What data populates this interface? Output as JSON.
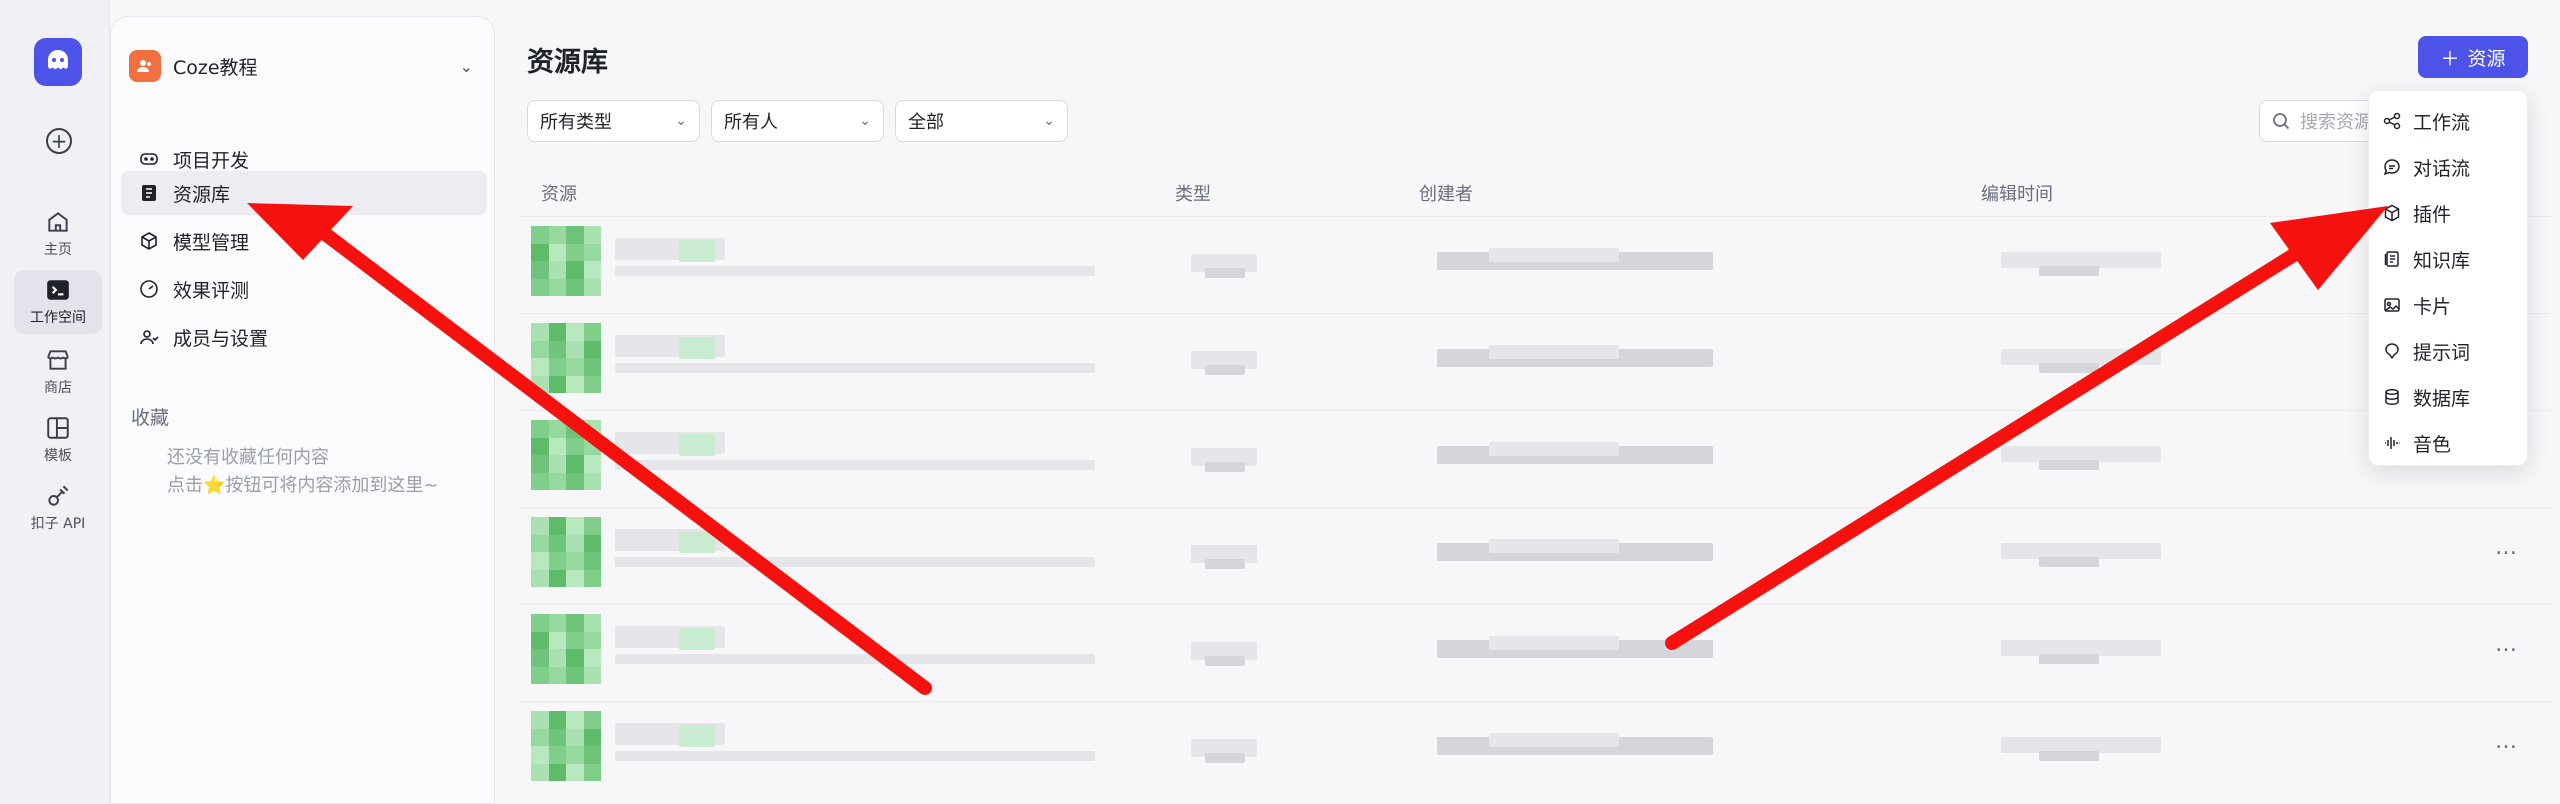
{
  "rail": {
    "logo_icon": "coze-logo-icon",
    "add_icon": "plus-circle-icon",
    "items": [
      {
        "label": "主页",
        "icon": "home-icon"
      },
      {
        "label": "工作空间",
        "icon": "terminal-icon",
        "active": true
      },
      {
        "label": "商店",
        "icon": "store-icon"
      },
      {
        "label": "模板",
        "icon": "layout-icon"
      },
      {
        "label": "扣子 API",
        "icon": "plug-icon"
      }
    ]
  },
  "sidebar": {
    "workspace": {
      "name": "Coze教程",
      "icon": "team-icon"
    },
    "nav": [
      {
        "label": "项目开发",
        "icon": "gamepad-icon"
      },
      {
        "label": "资源库",
        "icon": "library-icon",
        "active": true
      },
      {
        "label": "模型管理",
        "icon": "cube-icon"
      },
      {
        "label": "效果评测",
        "icon": "gauge-icon"
      },
      {
        "label": "成员与设置",
        "icon": "members-icon"
      }
    ],
    "favorites": {
      "title": "收藏",
      "empty_line1": "还没有收藏任何内容",
      "empty_line2": "点击⭐按钮可将内容添加到这里~"
    }
  },
  "main": {
    "title": "资源库",
    "add_button": "资源",
    "filters": [
      "所有类型",
      "所有人",
      "全部"
    ],
    "search_placeholder": "搜索资源",
    "columns": [
      "资源",
      "类型",
      "创建者",
      "编辑时间"
    ],
    "row_count": 6,
    "row_action": "…"
  },
  "menu": {
    "items": [
      {
        "label": "工作流",
        "icon": "workflow-icon"
      },
      {
        "label": "对话流",
        "icon": "chatflow-icon"
      },
      {
        "label": "插件",
        "icon": "plugin-icon"
      },
      {
        "label": "知识库",
        "icon": "knowledge-icon"
      },
      {
        "label": "卡片",
        "icon": "card-icon"
      },
      {
        "label": "提示词",
        "icon": "prompt-icon"
      },
      {
        "label": "数据库",
        "icon": "database-icon"
      },
      {
        "label": "音色",
        "icon": "voice-icon"
      }
    ]
  },
  "colors": {
    "accent": "#4d53e8",
    "annotation_arrow": "#f5120e",
    "workspace_avatar": "#f0703f",
    "thumbnail_green": "#7fcf8a"
  }
}
